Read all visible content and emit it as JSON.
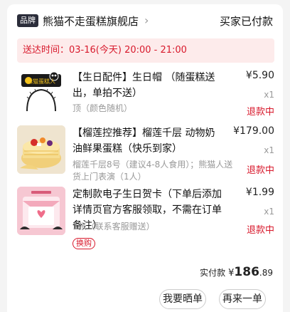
{
  "shop": {
    "badge": "品牌",
    "name": "熊猫不走蛋糕旗舰店",
    "chevron": "chevron-right-icon",
    "status": "买家已付款"
  },
  "delivery": {
    "label": "送达时间：",
    "value": "03-16(今天) 20:00 - 21:00"
  },
  "items": [
    {
      "title": "【生日配件】生日帽 （随蛋糕送出，单拍不送）",
      "price": "¥5.90",
      "qty": "x1",
      "spec": "顶（颜色随机）",
      "status": "退款中",
      "thumb_text": "熊猫蛋糕人"
    },
    {
      "title": "【榴莲控推荐】榴莲千层 动物奶油鲜果蛋糕（快乐到家）",
      "price": "¥179.00",
      "qty": "x1",
      "spec": "榴莲千层8号（建议4-8人食用）；熊猫人送货上门表演（1人）",
      "status": "退款中"
    },
    {
      "title": "定制款电子生日贺卡（下单后添加详情页官方客服领取，不需在订单备注）",
      "price": "¥1.99",
      "qty": "x1",
      "spec": "1张（联系客服赠送）",
      "status": "退款中",
      "tag": "换购"
    }
  ],
  "payment": {
    "label": "实付款",
    "yen": "¥",
    "amount": "186",
    "cents": ".89"
  },
  "actions": {
    "review": "我要晒单",
    "reorder": "再来一单"
  },
  "colors": {
    "accent": "#d8192c",
    "delivery_bg": "#fdebeb",
    "badge_bg": "#2b2d3a"
  }
}
